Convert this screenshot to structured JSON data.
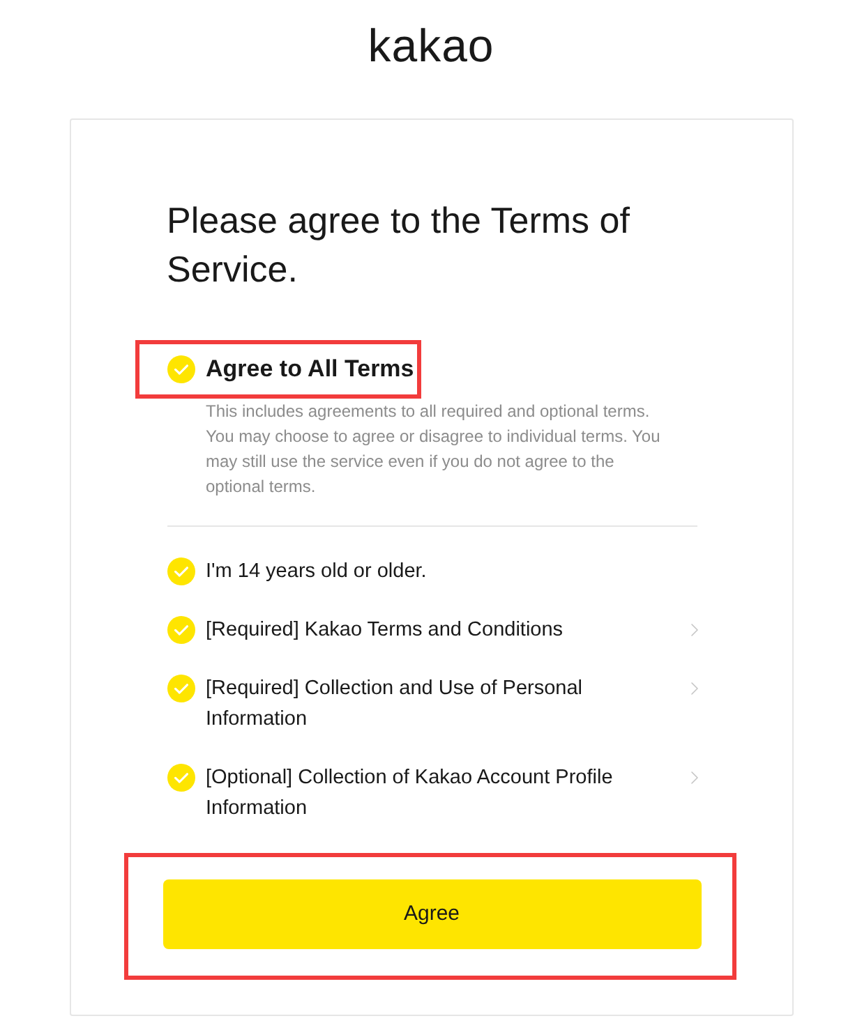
{
  "logo": {
    "text": "kakao"
  },
  "title": "Please agree to the Terms of Service.",
  "agree_all": {
    "label": "Agree to All Terms",
    "checked": true,
    "highlighted": true,
    "description": "This includes agreements to all required and optional terms. You may choose to agree or disagree to individual terms. You may still use the service even if you do not agree to the optional terms."
  },
  "terms": [
    {
      "label": "I'm 14 years old or older.",
      "checked": true,
      "has_details": false
    },
    {
      "label": "[Required] Kakao Terms and Conditions",
      "checked": true,
      "has_details": true
    },
    {
      "label": "[Required] Collection and Use of Personal Information",
      "checked": true,
      "has_details": true
    },
    {
      "label": "[Optional] Collection of Kakao Account Profile Information",
      "checked": true,
      "has_details": true
    }
  ],
  "submit": {
    "label": "Agree",
    "highlighted": true
  }
}
